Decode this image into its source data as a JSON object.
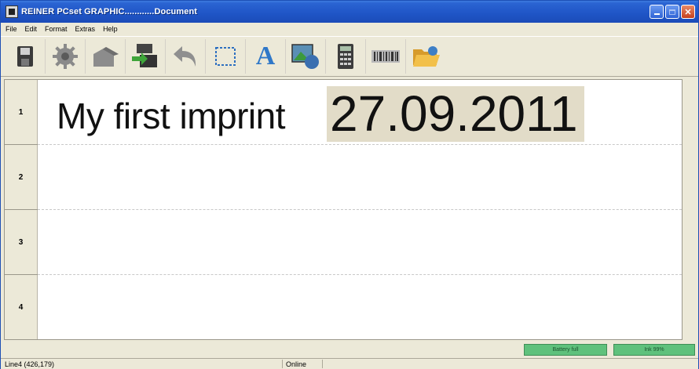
{
  "window": {
    "title": "REINER PCset GRAPHIC............Document"
  },
  "menu": [
    "File",
    "Edit",
    "Format",
    "Extras",
    "Help"
  ],
  "toolbar": [
    {
      "name": "save-icon"
    },
    {
      "name": "settings-gear-icon"
    },
    {
      "name": "home-icon"
    },
    {
      "name": "print-transfer-icon"
    },
    {
      "name": "undo-icon"
    },
    {
      "name": "selection-frame-icon"
    },
    {
      "name": "text-tool-icon",
      "glyph": "A"
    },
    {
      "name": "image-tool-icon"
    },
    {
      "name": "calculator-icon"
    },
    {
      "name": "barcode-icon"
    },
    {
      "name": "open-folder-icon"
    }
  ],
  "document": {
    "rows": [
      {
        "number": "1",
        "text": "My first imprint",
        "date": "27.09.2011"
      },
      {
        "number": "2"
      },
      {
        "number": "3"
      },
      {
        "number": "4"
      }
    ]
  },
  "indicators": {
    "battery": "Battery full",
    "ink": "Ink 99%"
  },
  "status": {
    "position": "Line4 (426,179)",
    "connection": "Online"
  },
  "colors": {
    "titlebar": "#1f55c6",
    "indicator_green": "#5fc17c",
    "date_highlight": "#e2dcc8"
  }
}
